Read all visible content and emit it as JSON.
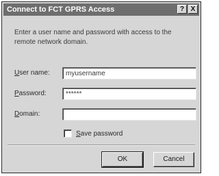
{
  "window": {
    "title": "Connect to FCT GPRS Access",
    "help_button": "?",
    "close_button": "X"
  },
  "dialog": {
    "intro_text": "Enter a user name and password with access to the remote network domain.",
    "fields": {
      "username": {
        "label_underlined": "U",
        "label_rest": "ser name:",
        "value": "myusername"
      },
      "password": {
        "label_underlined": "P",
        "label_rest": "assword:",
        "value": "******"
      },
      "domain": {
        "label_underlined": "D",
        "label_rest": "omain:",
        "value": ""
      }
    },
    "save_password": {
      "label_underlined": "S",
      "label_rest": "ave password",
      "checked": false
    },
    "buttons": {
      "ok": "OK",
      "cancel": "Cancel"
    }
  },
  "colors": {
    "titlebar": "#6e6e6e",
    "dialog_bg": "#d6d6d6",
    "field_bg": "#ffffff"
  }
}
